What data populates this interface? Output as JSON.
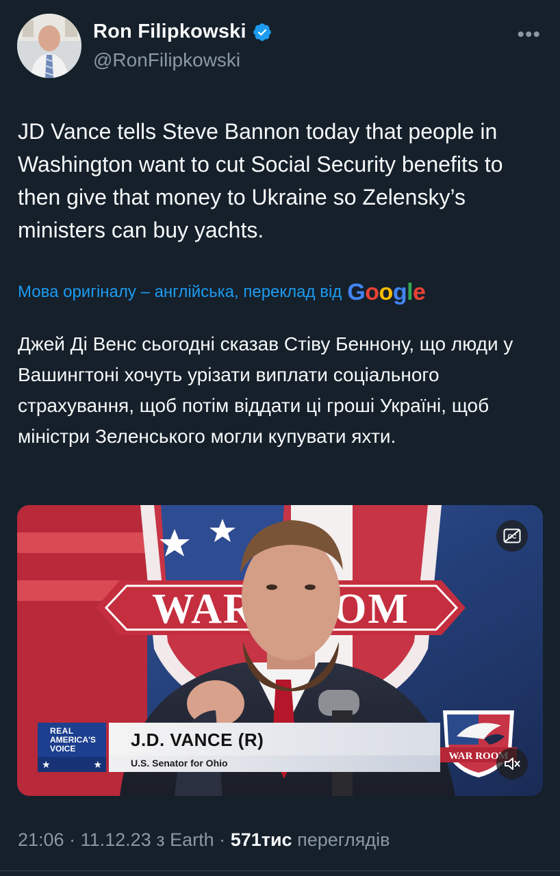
{
  "author": {
    "display_name": "Ron Filipkowski",
    "handle": "@RonFilipkowski",
    "verified": true,
    "verified_badge_color": "#1d9bf0"
  },
  "tweet": {
    "text": "JD Vance tells Steve Bannon today that people in Washington want to cut Social Security benefits to then give that money to Ukraine so Zelensky’s ministers can buy yachts.",
    "translation_label": "Мова оригіналу – англійська, переклад від",
    "translation_provider": "Google",
    "translated_text": "Джей Ді Венс сьогодні сказав Стіву Беннону, що люди у Вашингтоні хочуть урізати виплати соціального страхування, щоб потім віддати ці гроші Україні, щоб міністри Зеленського могли купувати яхти."
  },
  "video": {
    "backdrop_sign": "WAR ROOM",
    "lower_third": {
      "network_line1": "REAL",
      "network_line2": "AMERICA'S",
      "network_line3": "VOICE",
      "name": "J.D. VANCE (R)",
      "title": "U.S. Senator for Ohio",
      "show_badge": "WAR ROOM"
    },
    "icons": [
      "closed-captions-icon",
      "mute-icon"
    ]
  },
  "footer": {
    "time": "21:06",
    "date": "11.12.23",
    "source": "з Earth",
    "views_count": "571тис",
    "views_label": "переглядів",
    "separator": "·"
  },
  "colors": {
    "background": "#15202b",
    "text_primary": "#f7f9f9",
    "text_secondary": "#8b98a5",
    "link": "#1d9bf0"
  }
}
